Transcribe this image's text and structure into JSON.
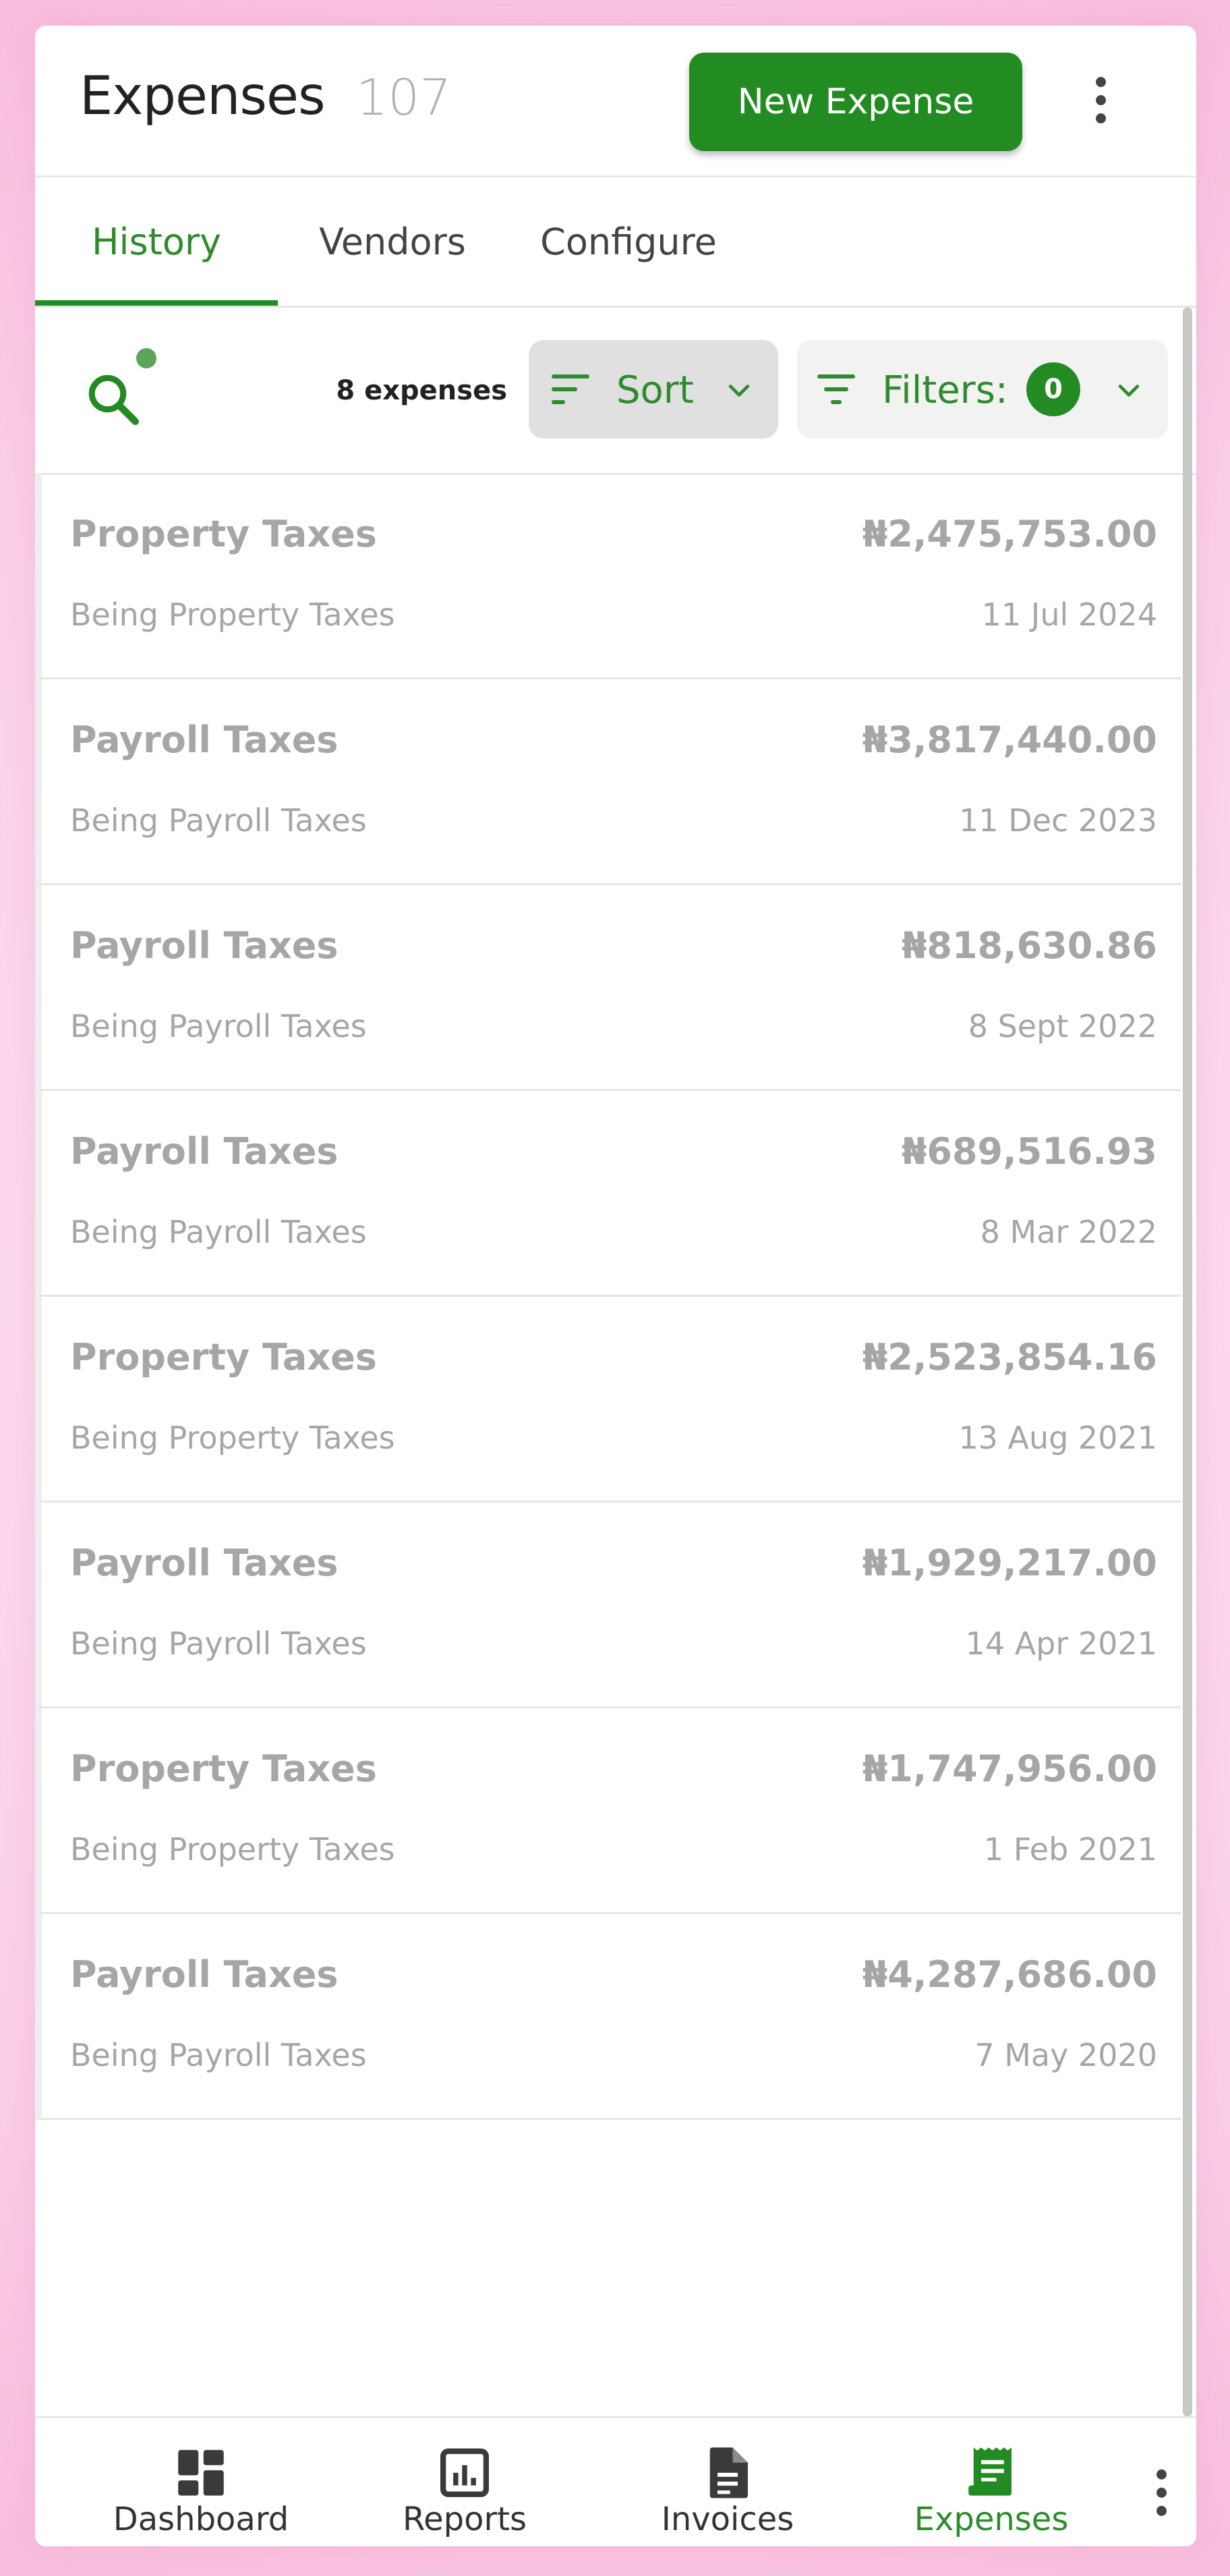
{
  "header": {
    "title": "Expenses",
    "count": "107",
    "new_expense_label": "New Expense"
  },
  "tabs": [
    {
      "label": "History",
      "active": true
    },
    {
      "label": "Vendors",
      "active": false
    },
    {
      "label": "Configure",
      "active": false
    }
  ],
  "toolbar": {
    "expense_count": "8 expenses",
    "sort_label": "Sort",
    "filters_label": "Filters:",
    "filters_count": "0"
  },
  "expenses": [
    {
      "name": "Property Taxes",
      "description": "Being Property Taxes",
      "amount": "₦2,475,753.00",
      "date": "11 Jul 2024"
    },
    {
      "name": "Payroll Taxes",
      "description": "Being Payroll Taxes",
      "amount": "₦3,817,440.00",
      "date": "11 Dec 2023"
    },
    {
      "name": "Payroll Taxes",
      "description": "Being Payroll Taxes",
      "amount": "₦818,630.86",
      "date": "8 Sept 2022"
    },
    {
      "name": "Payroll Taxes",
      "description": "Being Payroll Taxes",
      "amount": "₦689,516.93",
      "date": "8 Mar 2022"
    },
    {
      "name": "Property Taxes",
      "description": "Being Property Taxes",
      "amount": "₦2,523,854.16",
      "date": "13 Aug 2021"
    },
    {
      "name": "Payroll Taxes",
      "description": "Being Payroll Taxes",
      "amount": "₦1,929,217.00",
      "date": "14 Apr 2021"
    },
    {
      "name": "Property Taxes",
      "description": "Being Property Taxes",
      "amount": "₦1,747,956.00",
      "date": "1 Feb 2021"
    },
    {
      "name": "Payroll Taxes",
      "description": "Being Payroll Taxes",
      "amount": "₦4,287,686.00",
      "date": "7 May 2020"
    }
  ],
  "bottom_nav": [
    {
      "label": "Dashboard",
      "icon": "dashboard-icon",
      "active": false
    },
    {
      "label": "Reports",
      "icon": "reports-icon",
      "active": false
    },
    {
      "label": "Invoices",
      "icon": "invoices-icon",
      "active": false
    },
    {
      "label": "Expenses",
      "icon": "expenses-icon",
      "active": true
    }
  ],
  "colors": {
    "accent": "#228b22",
    "muted_text": "#a6a6a6",
    "background": "#fbcde6"
  }
}
